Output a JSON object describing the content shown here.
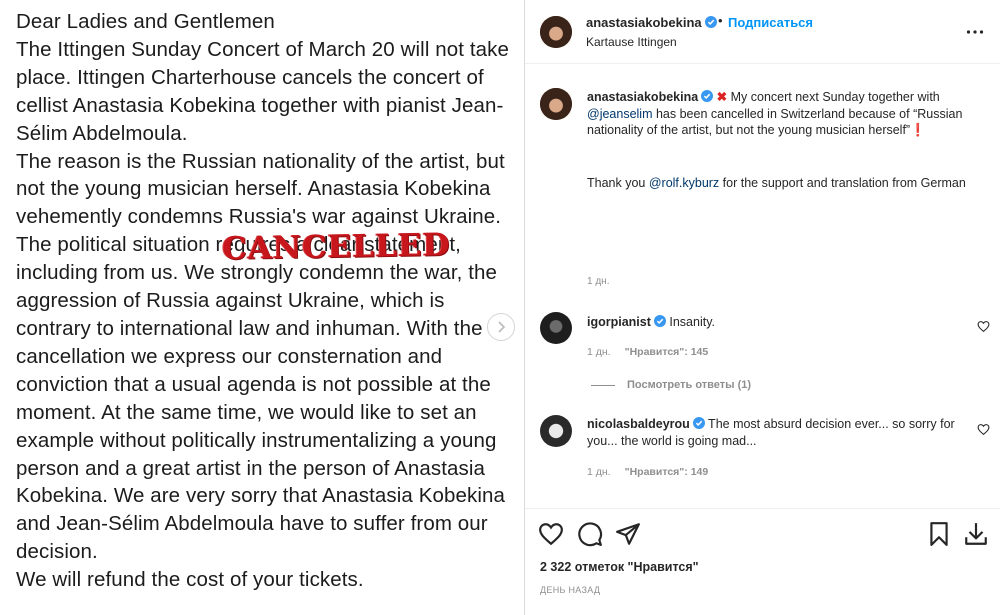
{
  "post_image": {
    "paragraphs": [
      "Dear Ladies and Gentlemen",
      "The Ittingen Sunday Concert of March 20 will not take place. Ittingen Charterhouse cancels the concert of cellist Anastasia Kobekina together with pianist Jean-Sélim Abdelmoula.",
      "The reason is the Russian nationality of the artist, but not the young musician herself. Anastasia Kobekina vehemently condemns Russia's war against Ukraine.",
      "The political situation requires a clear statement, including from us. We strongly condemn the war, the aggression of Russia against Ukraine, which is contrary to international law and inhuman. With the cancellation we express our consternation and conviction that a usual agenda is not possible at the moment. At the same time, we would like to set an example without politically instrumentalizing a young person and a great artist in the person of Anastasia Kobekina. We are very sorry that Anastasia Kobekina and Jean-Sélim Abdelmoula have to suffer from our decision.",
      "We will refund the cost of your tickets."
    ],
    "stamp": "CANCELLED"
  },
  "header": {
    "username": "anastasiakobekina",
    "dot": "•",
    "follow_label": "Подписаться",
    "location": "Kartause Ittingen"
  },
  "caption": {
    "username": "anastasiakobekina",
    "cross": "✖",
    "text_1": " My concert next Sunday together with ",
    "mention_1": "@jeanselim",
    "text_2": " has been cancelled in Switzerland because of “Russian nationality of the artist, but not the young musician herself”",
    "excl": "❗",
    "thanks_1": "Thank you ",
    "mention_2": "@rolf.kyburz",
    "thanks_2": " for the support and translation from German",
    "time": "1 дн."
  },
  "comments": [
    {
      "username": "igorpianist",
      "text": " Insanity.",
      "time": "1 дн.",
      "likes": "\"Нравится\": 145",
      "replies": "Посмотреть ответы (1)"
    },
    {
      "username": "nicolasbaldeyrou",
      "text": " The most absurd decision ever... so sorry for you... the world is going mad...",
      "time": "1 дн.",
      "likes": "\"Нравится\": 149"
    }
  ],
  "footer": {
    "likes_count": "2 322 отметок \"Нравится\"",
    "date": "ДЕНЬ НАЗАД"
  },
  "colors": {
    "accent": "#0095f6",
    "verified": "#3897f0",
    "stamp": "#c7161c"
  },
  "icons": {
    "verified": "verified-badge-icon",
    "more": "more-horizontal-icon",
    "like": "heart-icon",
    "comment": "comment-bubble-icon",
    "share": "paper-plane-icon",
    "save": "bookmark-icon",
    "download": "download-icon",
    "next": "chevron-right-icon"
  }
}
